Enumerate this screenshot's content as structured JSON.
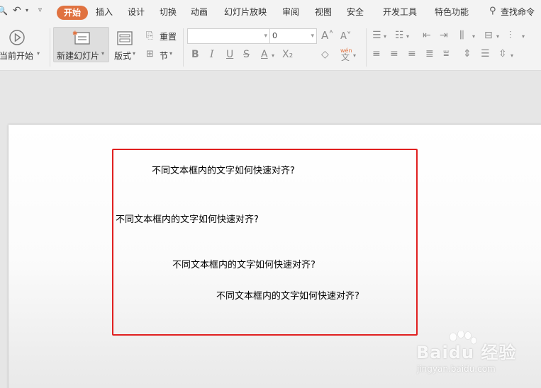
{
  "menu": {
    "items": [
      "开始",
      "插入",
      "设计",
      "切换",
      "动画",
      "幻灯片放映",
      "审阅",
      "视图",
      "安全",
      "开发工具",
      "特色功能"
    ],
    "search": "查找命令"
  },
  "ribbon": {
    "from_current": "当前开始",
    "new_slide": "新建幻灯片",
    "layout": "版式",
    "reset": "重置",
    "section": "节",
    "font_size_value": "0",
    "phonetic": "wén"
  },
  "slide": {
    "texts": [
      "不同文本框内的文字如何快速对齐?",
      "不同文本框内的文字如何快速对齐?",
      "不同文本框内的文字如何快速对齐?",
      "不同文本框内的文字如何快速对齐?"
    ]
  },
  "watermark": {
    "brand": "Bai",
    "brand_suffix": "经验",
    "url": "jingyan.baidu.com"
  },
  "colors": {
    "accent": "#e07240",
    "highlight_frame": "#e02020"
  }
}
